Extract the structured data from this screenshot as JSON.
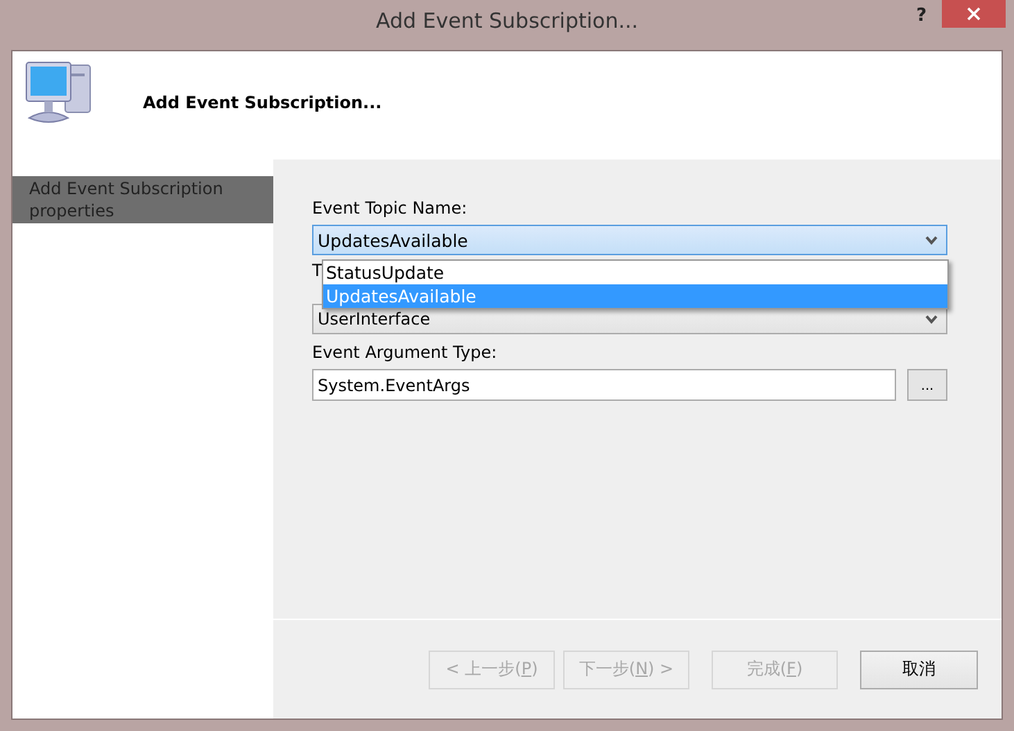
{
  "window": {
    "title": "Add Event Subscription...",
    "help": "?"
  },
  "header": {
    "title": "Add Event Subscription..."
  },
  "sidebar": {
    "items": [
      {
        "label": "Add Event Subscription properties",
        "selected": true
      }
    ]
  },
  "form": {
    "topic_label": "Event Topic Name:",
    "topic_value": "UpdatesAvailable",
    "dropdown_options": [
      {
        "label": "StatusUpdate",
        "selected": false
      },
      {
        "label": "UpdatesAvailable",
        "selected": true
      }
    ],
    "hidden_label": "T",
    "second_value": "UserInterface",
    "arg_label": "Event Argument Type:",
    "arg_value": "System.EventArgs",
    "browse": "..."
  },
  "buttons": [
    {
      "before": "< 上一步(",
      "key": "P",
      "after": ")",
      "disabled": true
    },
    {
      "before": "下一步(",
      "key": "N",
      "after": ") >",
      "disabled": true
    },
    {
      "before": "完成(",
      "key": "F",
      "after": ")",
      "disabled": true
    },
    {
      "before": "取消",
      "disabled": false
    }
  ]
}
